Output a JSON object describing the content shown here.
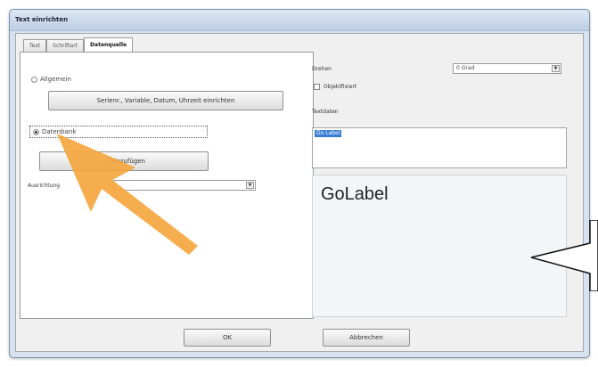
{
  "window": {
    "title": "Text einrichten"
  },
  "tabs": [
    {
      "label": "Text",
      "active": false
    },
    {
      "label": "Schriftart",
      "active": false
    },
    {
      "label": "Datenquelle",
      "active": true
    }
  ],
  "datasource": {
    "option_general": "Allgemein",
    "series_button": "Serienr., Variable, Datum, Uhrzeit einrichten",
    "option_database": "Datenbank",
    "add_button": "... hinzufügen",
    "alignment_label": "Ausrichtung",
    "alignment_value": ""
  },
  "right_panel": {
    "rotate_label": "Drehen",
    "rotate_value": "0 Grad",
    "objectfixed_label": "Objektfixiert",
    "textdata_label": "Textdaten",
    "textdata_value": "Go Label"
  },
  "preview": {
    "text": "GoLabel"
  },
  "footer": {
    "ok_label": "OK",
    "cancel_label": "Abbrechen"
  },
  "overlay": {
    "arrow_color": "#f5a43a",
    "callout_color": "#ffffff"
  },
  "icons": {
    "dropdown": "chevron-down-icon"
  }
}
